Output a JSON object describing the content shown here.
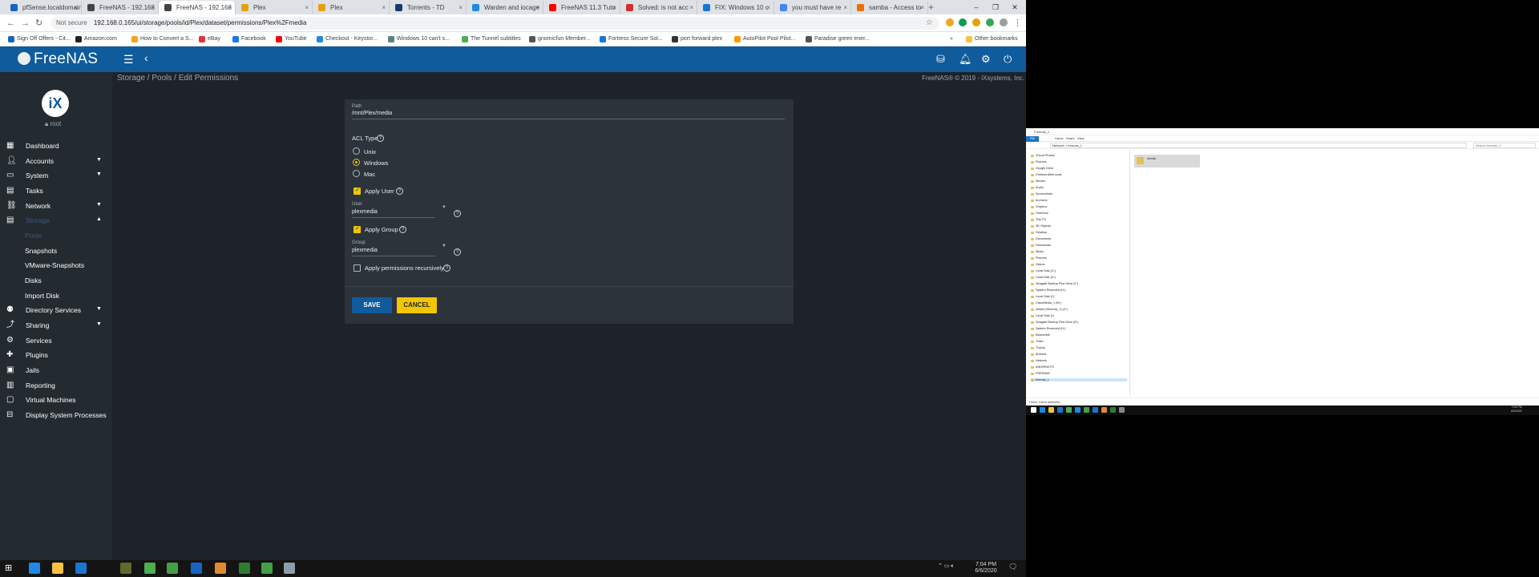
{
  "browser": {
    "tabs": [
      {
        "label": "pfSense.localdomain",
        "color": "#1565c0"
      },
      {
        "label": "FreeNAS - 192.168",
        "color": "#444444"
      },
      {
        "label": "FreeNAS - 192.168",
        "color": "#444444"
      },
      {
        "label": "Plex",
        "color": "#e5a00d"
      },
      {
        "label": "Plex",
        "color": "#e5a00d"
      },
      {
        "label": "Torrents - TD",
        "color": "#1a3a6e"
      },
      {
        "label": "Warden and iocage",
        "color": "#1e88e5"
      },
      {
        "label": "FreeNAS 11.3 Tuto",
        "color": "#ff0000"
      },
      {
        "label": "Solved: is not acc",
        "color": "#d32f2f"
      },
      {
        "label": "FIX: Windows 10 c",
        "color": "#1976d2"
      },
      {
        "label": "you must have re",
        "color": "#4285f4"
      },
      {
        "label": "samba - Access to",
        "color": "#ef6c00"
      }
    ],
    "new_tab": "+",
    "window_controls": [
      "–",
      "❐",
      "✕"
    ],
    "address": {
      "security": "Not secure",
      "url": "192.168.0.165/ui/storage/pools/id/Plex/dataset/permissions/Plex%2Fmedia"
    },
    "bookmarks": [
      "Sign Off Offers - Cit...",
      "Amazon.com",
      "How to Convert a S...",
      "eBay",
      "Facebook",
      "YouTube",
      "Checkout - Keystor...",
      "Windows 10 can't s...",
      "The Tunnel subtitles",
      "gnomicfun Member...",
      "Fortress Secure Sol...",
      "port forward plex",
      "AutoPilot Pool Pilot...",
      "Paradise green ener..."
    ],
    "other_bookmarks": "Other bookmarks"
  },
  "header": {
    "logo": "FreeNAS",
    "breadcrumb": "Storage  /  Pools  /  Edit Permissions",
    "copyright": "FreeNAS® © 2019 - iXsystems, Inc."
  },
  "sidebar": {
    "user": "root",
    "items": [
      {
        "label": "Dashboard"
      },
      {
        "label": "Accounts"
      },
      {
        "label": "System"
      },
      {
        "label": "Tasks"
      },
      {
        "label": "Network"
      },
      {
        "label": "Storage"
      },
      {
        "label": "Pools"
      },
      {
        "label": "Snapshots"
      },
      {
        "label": "VMware-Snapshots"
      },
      {
        "label": "Disks"
      },
      {
        "label": "Import Disk"
      },
      {
        "label": "Directory Services"
      },
      {
        "label": "Sharing"
      },
      {
        "label": "Services"
      },
      {
        "label": "Plugins"
      },
      {
        "label": "Jails"
      },
      {
        "label": "Reporting"
      },
      {
        "label": "Virtual Machines"
      },
      {
        "label": "Display System Processes"
      }
    ]
  },
  "form": {
    "path_label": "Path",
    "path_value": "/mnt/Plex/media",
    "acl_label": "ACL Type",
    "acl_options": [
      "Unix",
      "Windows",
      "Mac"
    ],
    "acl_selected": "Windows",
    "apply_user": "Apply User",
    "user_label": "User",
    "user_value": "plexmedia",
    "apply_group": "Apply Group",
    "group_label": "Group",
    "group_value": "plexmedia",
    "recursive": "Apply permissions recursively",
    "save": "SAVE",
    "cancel": "CANCEL"
  },
  "taskbar": {
    "time": "7:04 PM",
    "date": "6/6/2020"
  },
  "explorer": {
    "title": "Freenas_1",
    "ribbon": [
      "File",
      "Home",
      "Share",
      "View"
    ],
    "path": "Network > freenas_1",
    "search": "Search freenas_1",
    "tree": [
      "iCloud Photos",
      "Pictures",
      "Google Drive",
      "Chelsea Allen-local",
      "Movies",
      "Audio",
      "Screenshots",
      "Archives",
      "Dropbox",
      "OneDrive",
      "This PC",
      "3D Objects",
      "Desktop",
      "Documents",
      "Downloads",
      "Music",
      "Pictures",
      "Videos",
      "Local Disk (C:)",
      "Local Disk (D:)",
      "Seagate Backup Plus Drive (F:)",
      "System Reserved (H:)",
      "Local Disk (I:)",
      "CiscoMedia_1 (M:)",
      "media (\\\\freenas_1) (Z:)",
      "Local Disk (I:)",
      "Seagate Backup Plus Drive (E:)",
      "System Reserved (H:)",
      "Backedfull",
      "Trash",
      "Trophy",
      "Android",
      "Network",
      "ANDREW-PC",
      "FREENAS",
      "freenas_1"
    ],
    "folder": "media",
    "status": "1 item    1 item selected",
    "time": "7:04 PM",
    "date": "6/6/2020"
  }
}
